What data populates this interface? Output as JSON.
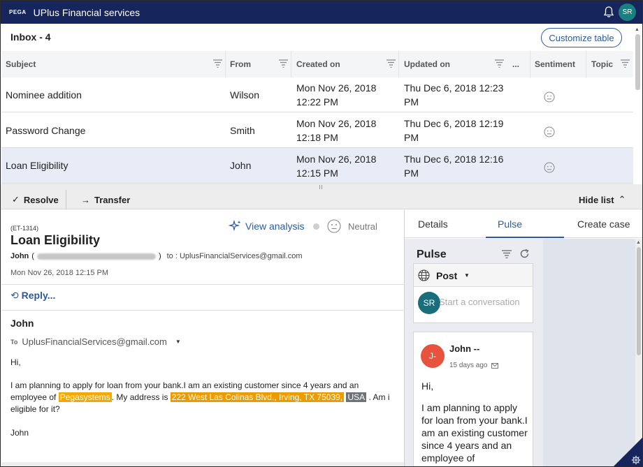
{
  "header": {
    "logo": "PEGA",
    "app_title": "UPlus Financial services",
    "avatar_initials": "SR",
    "bell_icon": "bell-icon"
  },
  "inbox": {
    "title": "Inbox - 4",
    "customize_label": "Customize table",
    "columns": [
      "Subject",
      "From",
      "Created on",
      "Updated on",
      "...",
      "Sentiment",
      "Topic"
    ],
    "rows": [
      {
        "subject": "Nominee addition",
        "from": "Wilson",
        "created_1": "Mon Nov 26, 2018",
        "created_2": "12:22 PM",
        "updated_1": "Thu Dec 6, 2018 12:23",
        "updated_2": "PM",
        "sentiment": "neutral-face-icon"
      },
      {
        "subject": "Password Change",
        "from": "Smith",
        "created_1": "Mon Nov 26, 2018",
        "created_2": "12:18 PM",
        "updated_1": "Thu Dec 6, 2018 12:19",
        "updated_2": "PM",
        "sentiment": "neutral-face-icon"
      },
      {
        "subject": "Loan Eligibility",
        "from": "John",
        "created_1": "Mon Nov 26, 2018",
        "created_2": "12:15 PM",
        "updated_1": "Thu Dec 6, 2018 12:16",
        "updated_2": "PM",
        "sentiment": "neutral-face-icon"
      }
    ]
  },
  "actions": {
    "resolve": "Resolve",
    "transfer": "Transfer",
    "hide_list": "Hide list"
  },
  "email": {
    "case_id": "(ET-1314)",
    "title": "Loan Eligibility",
    "view_analysis": "View analysis",
    "sentiment_label": "Neutral",
    "from_name": "John",
    "from_open": "(",
    "from_close": ")",
    "to_inline": "to : UplusFinancialServices@gmail.com",
    "date": "Mon Nov 26, 2018 12:15 PM",
    "reply": "Reply...",
    "sender": "John",
    "to_label": "To",
    "to_address": "UplusFinancialServices@gmail.com",
    "greeting": "Hi,",
    "body_1": "I am planning to apply for loan from your bank.I am an existing customer since 4 years and an",
    "body_2_a": "employee of ",
    "entity_org": "Pegasystems",
    "body_2_b": ". My address is ",
    "entity_address": "222 West Las Colinas Blvd., Irving, TX 75039,",
    "entity_country": "USA",
    "body_2_c": " . Am i",
    "body_3": "eligible for it?",
    "signature": "John"
  },
  "right_panel": {
    "tabs": [
      "Details",
      "Pulse",
      "Create case"
    ],
    "active_tab": "Pulse",
    "pulse_title": "Pulse",
    "post_label": "Post",
    "post_avatar": "SR",
    "post_placeholder": "Start a conversation",
    "message": {
      "avatar": "J-",
      "name": "John --",
      "time": "15 days ago",
      "greeting": "Hi,",
      "body": "I am planning to apply for loan from your bank.I am an existing customer since 4 years and an employee of"
    }
  },
  "colors": {
    "topbar": "#16255c",
    "accent": "#2b5aa3",
    "org_highlight": "#f6a800",
    "address_highlight": "#ec9b00",
    "country_highlight": "#6f7379"
  }
}
